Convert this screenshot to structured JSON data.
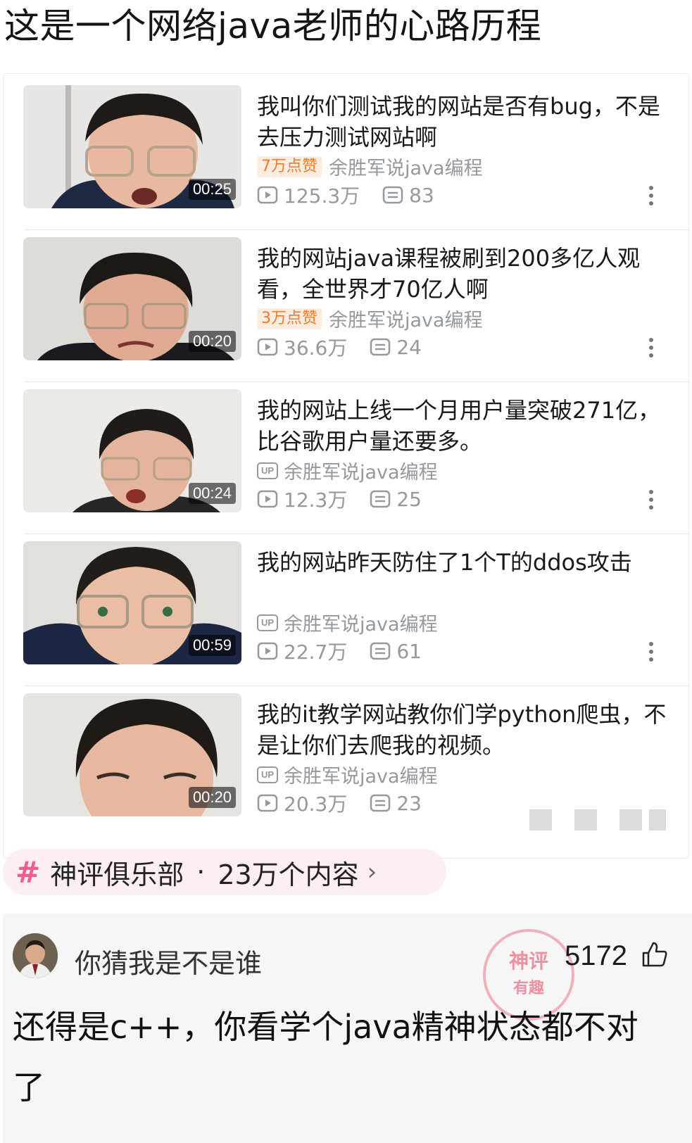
{
  "post_title": "这是一个网络java老师的心路历程",
  "videos": [
    {
      "title": "我叫你们测试我的网站是否有bug，不是去压力测试网站啊",
      "duration": "00:25",
      "likes_badge": "7万点赞",
      "author": "余胜军说java编程",
      "views": "125.3万",
      "comments": "83",
      "show_up_badge": false
    },
    {
      "title": "我的网站java课程被刷到200多亿人观看，全世界才70亿人啊",
      "duration": "00:20",
      "likes_badge": "3万点赞",
      "author": "余胜军说java编程",
      "views": "36.6万",
      "comments": "24",
      "show_up_badge": false
    },
    {
      "title": "我的网站上线一个月用户量突破271亿，比谷歌用户量还要多。",
      "duration": "00:24",
      "likes_badge": "",
      "author": "余胜军说java编程",
      "views": "12.3万",
      "comments": "25",
      "show_up_badge": true
    },
    {
      "title": "我的网站昨天防住了1个T的ddos攻击",
      "duration": "00:59",
      "likes_badge": "",
      "author": "余胜军说java编程",
      "views": "22.7万",
      "comments": "61",
      "show_up_badge": true
    },
    {
      "title": "我的it教学网站教你们学python爬虫，不是让你们去爬我的视频。",
      "duration": "00:20",
      "likes_badge": "",
      "author": "余胜军说java编程",
      "views": "20.3万",
      "comments": "23",
      "show_up_badge": true
    }
  ],
  "up_badge_text": "UP",
  "topic": {
    "hash": "#",
    "name": "神评俱乐部",
    "separator": "·",
    "count": "23万个内容",
    "chevron": "›"
  },
  "comment": {
    "username": "你猜我是不是谁",
    "like_count": "5172",
    "text": "还得是c++，你看学个java精神状态都不对了",
    "stamp_main": "神评",
    "stamp_sub": "有趣"
  },
  "colors": {
    "likes_orange": "#f17a2a",
    "meta_gray": "#9499a0",
    "topic_pink": "#f25d8e",
    "stamp_pink": "#e65a73"
  },
  "icons": {
    "play": "play-icon",
    "comment": "comment-icon",
    "more": "more-vertical-icon",
    "thumb_up": "thumb-up-icon"
  }
}
